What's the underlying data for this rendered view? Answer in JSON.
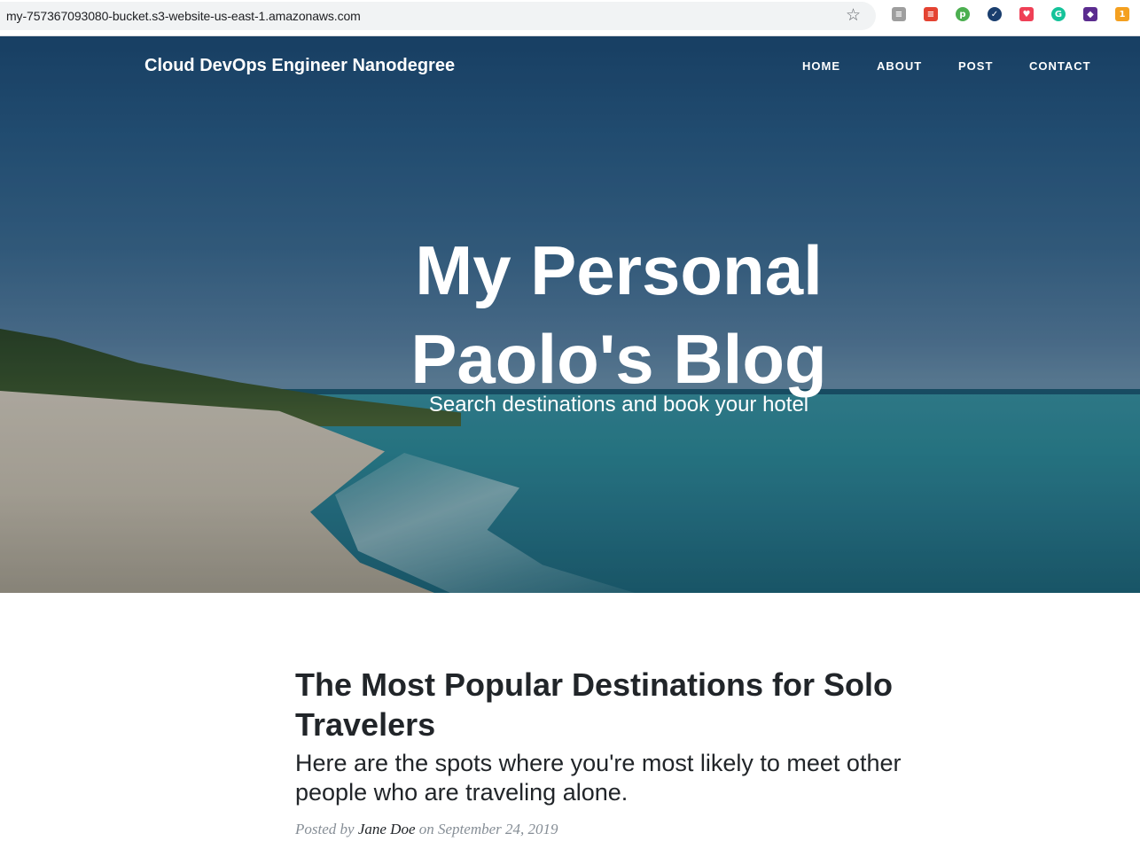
{
  "browser": {
    "url": "my-757367093080-bucket.s3-website-us-east-1.amazonaws.com",
    "bookmark_icon": "star-icon",
    "extensions": [
      {
        "name": "reader-extension-icon",
        "color": "#9e9e9e",
        "glyph": "≡"
      },
      {
        "name": "todoist-extension-icon",
        "color": "#e44332",
        "glyph": "≡"
      },
      {
        "name": "pushbullet-extension-icon",
        "color": "#4caf50",
        "glyph": "p"
      },
      {
        "name": "check-extension-icon",
        "color": "#1a3e6e",
        "glyph": "✓"
      },
      {
        "name": "pocket-extension-icon",
        "color": "#ef4056",
        "glyph": "♥"
      },
      {
        "name": "grammarly-extension-icon",
        "color": "#15c39a",
        "glyph": "G"
      },
      {
        "name": "mask-extension-icon",
        "color": "#5b2c8f",
        "glyph": "◆"
      },
      {
        "name": "pin-extension-icon",
        "color": "#f4a020",
        "glyph": "1"
      }
    ]
  },
  "site": {
    "brand": "Cloud DevOps Engineer Nanodegree",
    "nav": [
      {
        "label": "HOME"
      },
      {
        "label": "ABOUT"
      },
      {
        "label": "POST"
      },
      {
        "label": "CONTACT"
      }
    ]
  },
  "hero": {
    "title_line1": "My Personal",
    "title_line2": "Paolo's Blog",
    "subtitle": "Search destinations and book your hotel"
  },
  "post": {
    "title": "The Most Popular Destinations for Solo Travelers",
    "subtitle": "Here are the spots where you're most likely to meet other people who are traveling alone.",
    "meta_prefix": "Posted by",
    "author": "Jane Doe",
    "meta_mid": "on",
    "date": "September 24, 2019"
  }
}
